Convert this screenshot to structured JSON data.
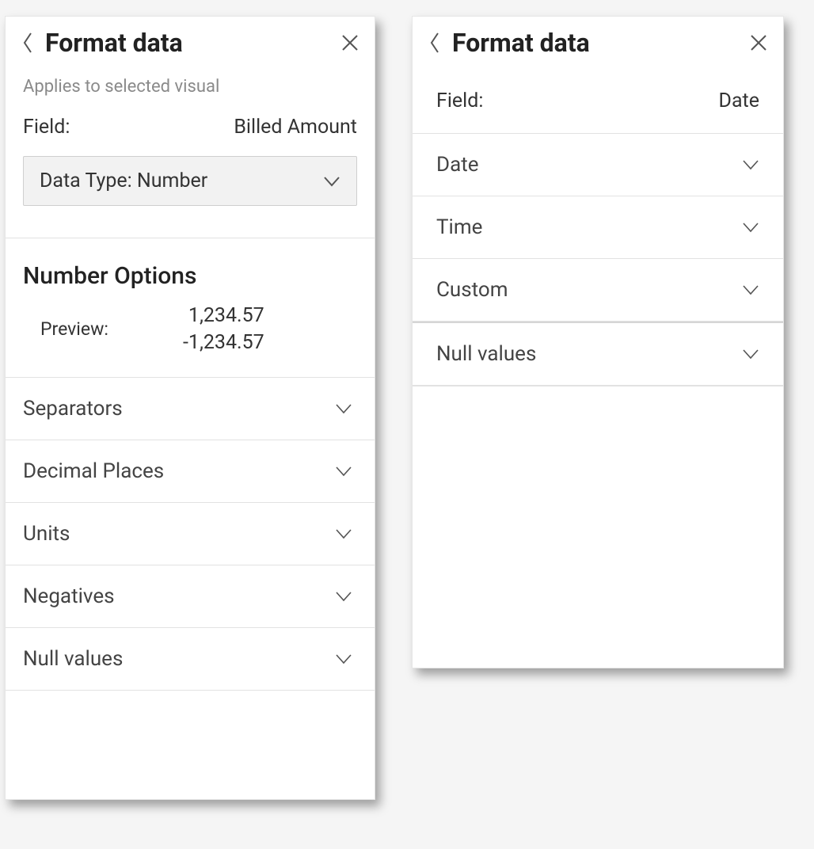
{
  "left": {
    "title": "Format data",
    "subtext": "Applies to selected visual",
    "field_label": "Field:",
    "field_value": "Billed Amount",
    "data_type_label": "Data Type: Number",
    "section_title": "Number Options",
    "preview_label": "Preview:",
    "preview_line1": "1,234.57",
    "preview_line2": "-1,234.57",
    "accordions": {
      "separators": "Separators",
      "decimal_places": "Decimal Places",
      "units": "Units",
      "negatives": "Negatives",
      "null_values": "Null values"
    }
  },
  "right": {
    "title": "Format data",
    "field_label": "Field:",
    "field_value": "Date",
    "accordions": {
      "date": "Date",
      "time": "Time",
      "custom": "Custom",
      "null_values": "Null values"
    }
  }
}
